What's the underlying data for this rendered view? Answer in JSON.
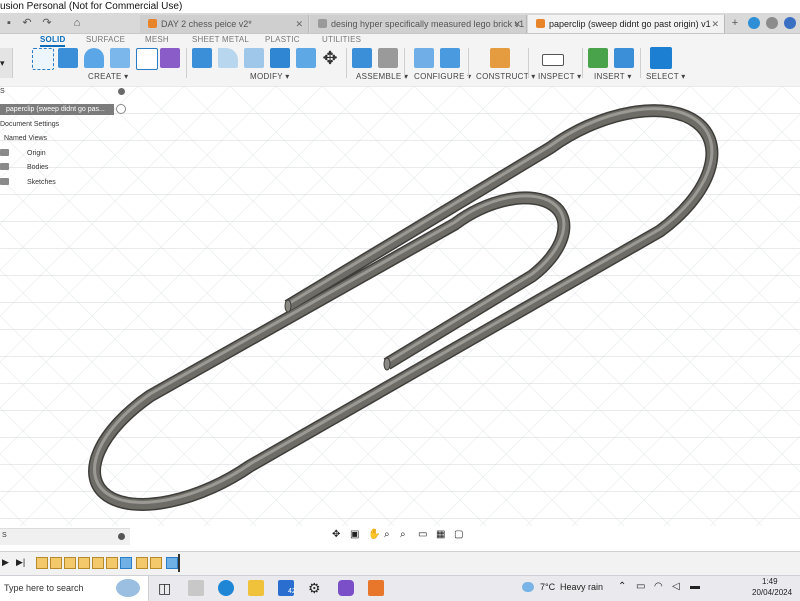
{
  "app": {
    "title": "usion Personal (Not for Commercial Use)"
  },
  "tabs": [
    {
      "label": "DAY 2 chess peice v2*",
      "active": false
    },
    {
      "label": "desing hyper specifically measured lego brick v1",
      "active": false
    },
    {
      "label": "paperclip (sweep didnt go past origin) v1",
      "active": true
    }
  ],
  "workspace_tabs": [
    "SOLID",
    "SURFACE",
    "MESH",
    "SHEET METAL",
    "PLASTIC",
    "UTILITIES"
  ],
  "tool_groups": {
    "create": "CREATE ▾",
    "modify": "MODIFY ▾",
    "assemble": "ASSEMBLE ▾",
    "configure": "CONFIGURE ▾",
    "construct": "CONSTRUCT ▾",
    "inspect": "INSPECT ▾",
    "insert": "INSERT ▾",
    "select": "SELECT ▾"
  },
  "browser": {
    "header_label": "S",
    "document": "paperclip (sweep didnt go pas...",
    "items": [
      "Document Settings",
      "Named Views",
      "Origin",
      "Bodies",
      "Sketches"
    ]
  },
  "comments": {
    "label": "S"
  },
  "taskbar": {
    "search_placeholder": "Type here to search",
    "badge_count": "42",
    "weather_temp": "7°C",
    "weather_text": "Heavy rain",
    "time": "1:49",
    "date": "20/04/2024"
  },
  "colors": {
    "accent": "#0a6ebd",
    "tab_active_bg": "#f2f2f2",
    "metal": "#6e6c66",
    "grid": "#cfd3d8"
  }
}
